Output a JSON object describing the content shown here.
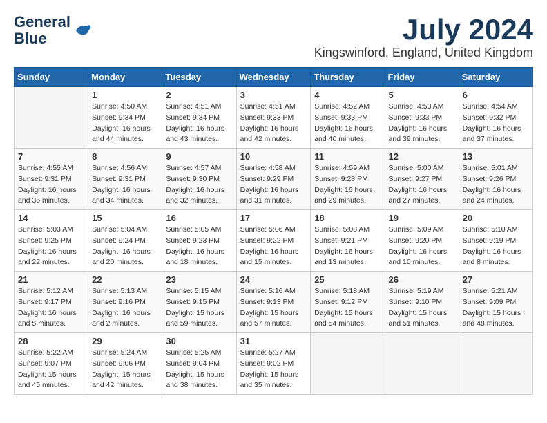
{
  "header": {
    "logo_line1": "General",
    "logo_line2": "Blue",
    "month": "July 2024",
    "location": "Kingswinford, England, United Kingdom"
  },
  "weekdays": [
    "Sunday",
    "Monday",
    "Tuesday",
    "Wednesday",
    "Thursday",
    "Friday",
    "Saturday"
  ],
  "weeks": [
    [
      {
        "day": "",
        "sunrise": "",
        "sunset": "",
        "daylight": ""
      },
      {
        "day": "1",
        "sunrise": "Sunrise: 4:50 AM",
        "sunset": "Sunset: 9:34 PM",
        "daylight": "Daylight: 16 hours and 44 minutes."
      },
      {
        "day": "2",
        "sunrise": "Sunrise: 4:51 AM",
        "sunset": "Sunset: 9:34 PM",
        "daylight": "Daylight: 16 hours and 43 minutes."
      },
      {
        "day": "3",
        "sunrise": "Sunrise: 4:51 AM",
        "sunset": "Sunset: 9:33 PM",
        "daylight": "Daylight: 16 hours and 42 minutes."
      },
      {
        "day": "4",
        "sunrise": "Sunrise: 4:52 AM",
        "sunset": "Sunset: 9:33 PM",
        "daylight": "Daylight: 16 hours and 40 minutes."
      },
      {
        "day": "5",
        "sunrise": "Sunrise: 4:53 AM",
        "sunset": "Sunset: 9:33 PM",
        "daylight": "Daylight: 16 hours and 39 minutes."
      },
      {
        "day": "6",
        "sunrise": "Sunrise: 4:54 AM",
        "sunset": "Sunset: 9:32 PM",
        "daylight": "Daylight: 16 hours and 37 minutes."
      }
    ],
    [
      {
        "day": "7",
        "sunrise": "Sunrise: 4:55 AM",
        "sunset": "Sunset: 9:31 PM",
        "daylight": "Daylight: 16 hours and 36 minutes."
      },
      {
        "day": "8",
        "sunrise": "Sunrise: 4:56 AM",
        "sunset": "Sunset: 9:31 PM",
        "daylight": "Daylight: 16 hours and 34 minutes."
      },
      {
        "day": "9",
        "sunrise": "Sunrise: 4:57 AM",
        "sunset": "Sunset: 9:30 PM",
        "daylight": "Daylight: 16 hours and 32 minutes."
      },
      {
        "day": "10",
        "sunrise": "Sunrise: 4:58 AM",
        "sunset": "Sunset: 9:29 PM",
        "daylight": "Daylight: 16 hours and 31 minutes."
      },
      {
        "day": "11",
        "sunrise": "Sunrise: 4:59 AM",
        "sunset": "Sunset: 9:28 PM",
        "daylight": "Daylight: 16 hours and 29 minutes."
      },
      {
        "day": "12",
        "sunrise": "Sunrise: 5:00 AM",
        "sunset": "Sunset: 9:27 PM",
        "daylight": "Daylight: 16 hours and 27 minutes."
      },
      {
        "day": "13",
        "sunrise": "Sunrise: 5:01 AM",
        "sunset": "Sunset: 9:26 PM",
        "daylight": "Daylight: 16 hours and 24 minutes."
      }
    ],
    [
      {
        "day": "14",
        "sunrise": "Sunrise: 5:03 AM",
        "sunset": "Sunset: 9:25 PM",
        "daylight": "Daylight: 16 hours and 22 minutes."
      },
      {
        "day": "15",
        "sunrise": "Sunrise: 5:04 AM",
        "sunset": "Sunset: 9:24 PM",
        "daylight": "Daylight: 16 hours and 20 minutes."
      },
      {
        "day": "16",
        "sunrise": "Sunrise: 5:05 AM",
        "sunset": "Sunset: 9:23 PM",
        "daylight": "Daylight: 16 hours and 18 minutes."
      },
      {
        "day": "17",
        "sunrise": "Sunrise: 5:06 AM",
        "sunset": "Sunset: 9:22 PM",
        "daylight": "Daylight: 16 hours and 15 minutes."
      },
      {
        "day": "18",
        "sunrise": "Sunrise: 5:08 AM",
        "sunset": "Sunset: 9:21 PM",
        "daylight": "Daylight: 16 hours and 13 minutes."
      },
      {
        "day": "19",
        "sunrise": "Sunrise: 5:09 AM",
        "sunset": "Sunset: 9:20 PM",
        "daylight": "Daylight: 16 hours and 10 minutes."
      },
      {
        "day": "20",
        "sunrise": "Sunrise: 5:10 AM",
        "sunset": "Sunset: 9:19 PM",
        "daylight": "Daylight: 16 hours and 8 minutes."
      }
    ],
    [
      {
        "day": "21",
        "sunrise": "Sunrise: 5:12 AM",
        "sunset": "Sunset: 9:17 PM",
        "daylight": "Daylight: 16 hours and 5 minutes."
      },
      {
        "day": "22",
        "sunrise": "Sunrise: 5:13 AM",
        "sunset": "Sunset: 9:16 PM",
        "daylight": "Daylight: 16 hours and 2 minutes."
      },
      {
        "day": "23",
        "sunrise": "Sunrise: 5:15 AM",
        "sunset": "Sunset: 9:15 PM",
        "daylight": "Daylight: 15 hours and 59 minutes."
      },
      {
        "day": "24",
        "sunrise": "Sunrise: 5:16 AM",
        "sunset": "Sunset: 9:13 PM",
        "daylight": "Daylight: 15 hours and 57 minutes."
      },
      {
        "day": "25",
        "sunrise": "Sunrise: 5:18 AM",
        "sunset": "Sunset: 9:12 PM",
        "daylight": "Daylight: 15 hours and 54 minutes."
      },
      {
        "day": "26",
        "sunrise": "Sunrise: 5:19 AM",
        "sunset": "Sunset: 9:10 PM",
        "daylight": "Daylight: 15 hours and 51 minutes."
      },
      {
        "day": "27",
        "sunrise": "Sunrise: 5:21 AM",
        "sunset": "Sunset: 9:09 PM",
        "daylight": "Daylight: 15 hours and 48 minutes."
      }
    ],
    [
      {
        "day": "28",
        "sunrise": "Sunrise: 5:22 AM",
        "sunset": "Sunset: 9:07 PM",
        "daylight": "Daylight: 15 hours and 45 minutes."
      },
      {
        "day": "29",
        "sunrise": "Sunrise: 5:24 AM",
        "sunset": "Sunset: 9:06 PM",
        "daylight": "Daylight: 15 hours and 42 minutes."
      },
      {
        "day": "30",
        "sunrise": "Sunrise: 5:25 AM",
        "sunset": "Sunset: 9:04 PM",
        "daylight": "Daylight: 15 hours and 38 minutes."
      },
      {
        "day": "31",
        "sunrise": "Sunrise: 5:27 AM",
        "sunset": "Sunset: 9:02 PM",
        "daylight": "Daylight: 15 hours and 35 minutes."
      },
      {
        "day": "",
        "sunrise": "",
        "sunset": "",
        "daylight": ""
      },
      {
        "day": "",
        "sunrise": "",
        "sunset": "",
        "daylight": ""
      },
      {
        "day": "",
        "sunrise": "",
        "sunset": "",
        "daylight": ""
      }
    ]
  ]
}
